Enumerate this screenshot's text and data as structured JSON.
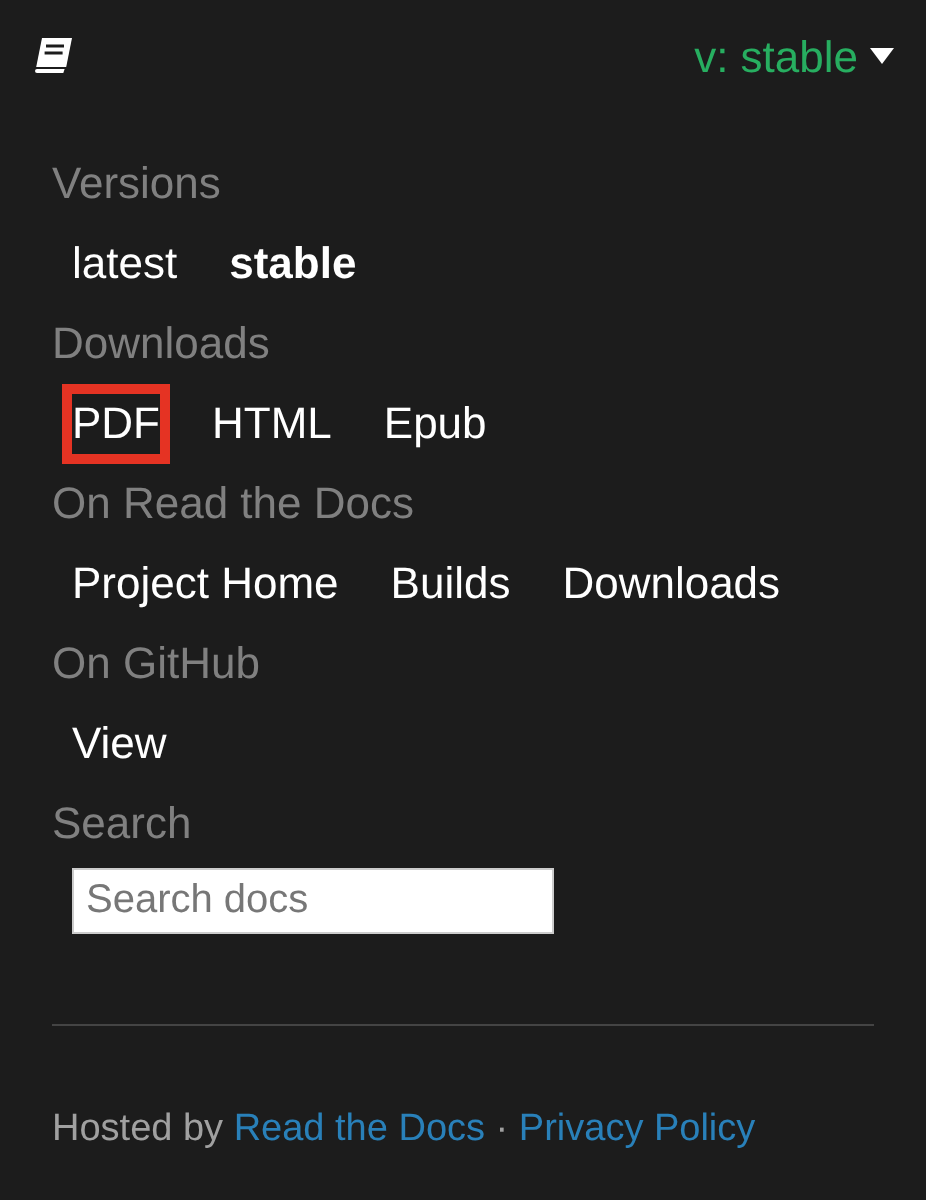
{
  "header": {
    "version_label": "v: stable"
  },
  "sections": [
    {
      "title": "Versions",
      "links": [
        {
          "label": "latest",
          "selected": false,
          "highlighted": false
        },
        {
          "label": "stable",
          "selected": true,
          "highlighted": false
        }
      ]
    },
    {
      "title": "Downloads",
      "links": [
        {
          "label": "PDF",
          "selected": false,
          "highlighted": true
        },
        {
          "label": "HTML",
          "selected": false,
          "highlighted": false
        },
        {
          "label": "Epub",
          "selected": false,
          "highlighted": false
        }
      ]
    },
    {
      "title": "On Read the Docs",
      "links": [
        {
          "label": "Project Home",
          "selected": false,
          "highlighted": false
        },
        {
          "label": "Builds",
          "selected": false,
          "highlighted": false
        },
        {
          "label": "Downloads",
          "selected": false,
          "highlighted": false
        }
      ]
    },
    {
      "title": "On GitHub",
      "links": [
        {
          "label": "View",
          "selected": false,
          "highlighted": false
        }
      ]
    }
  ],
  "search": {
    "title": "Search",
    "placeholder": "Search docs"
  },
  "footer": {
    "prefix": "Hosted by",
    "link_1": "Read the Docs",
    "separator": "·",
    "link_2": "Privacy Policy"
  }
}
